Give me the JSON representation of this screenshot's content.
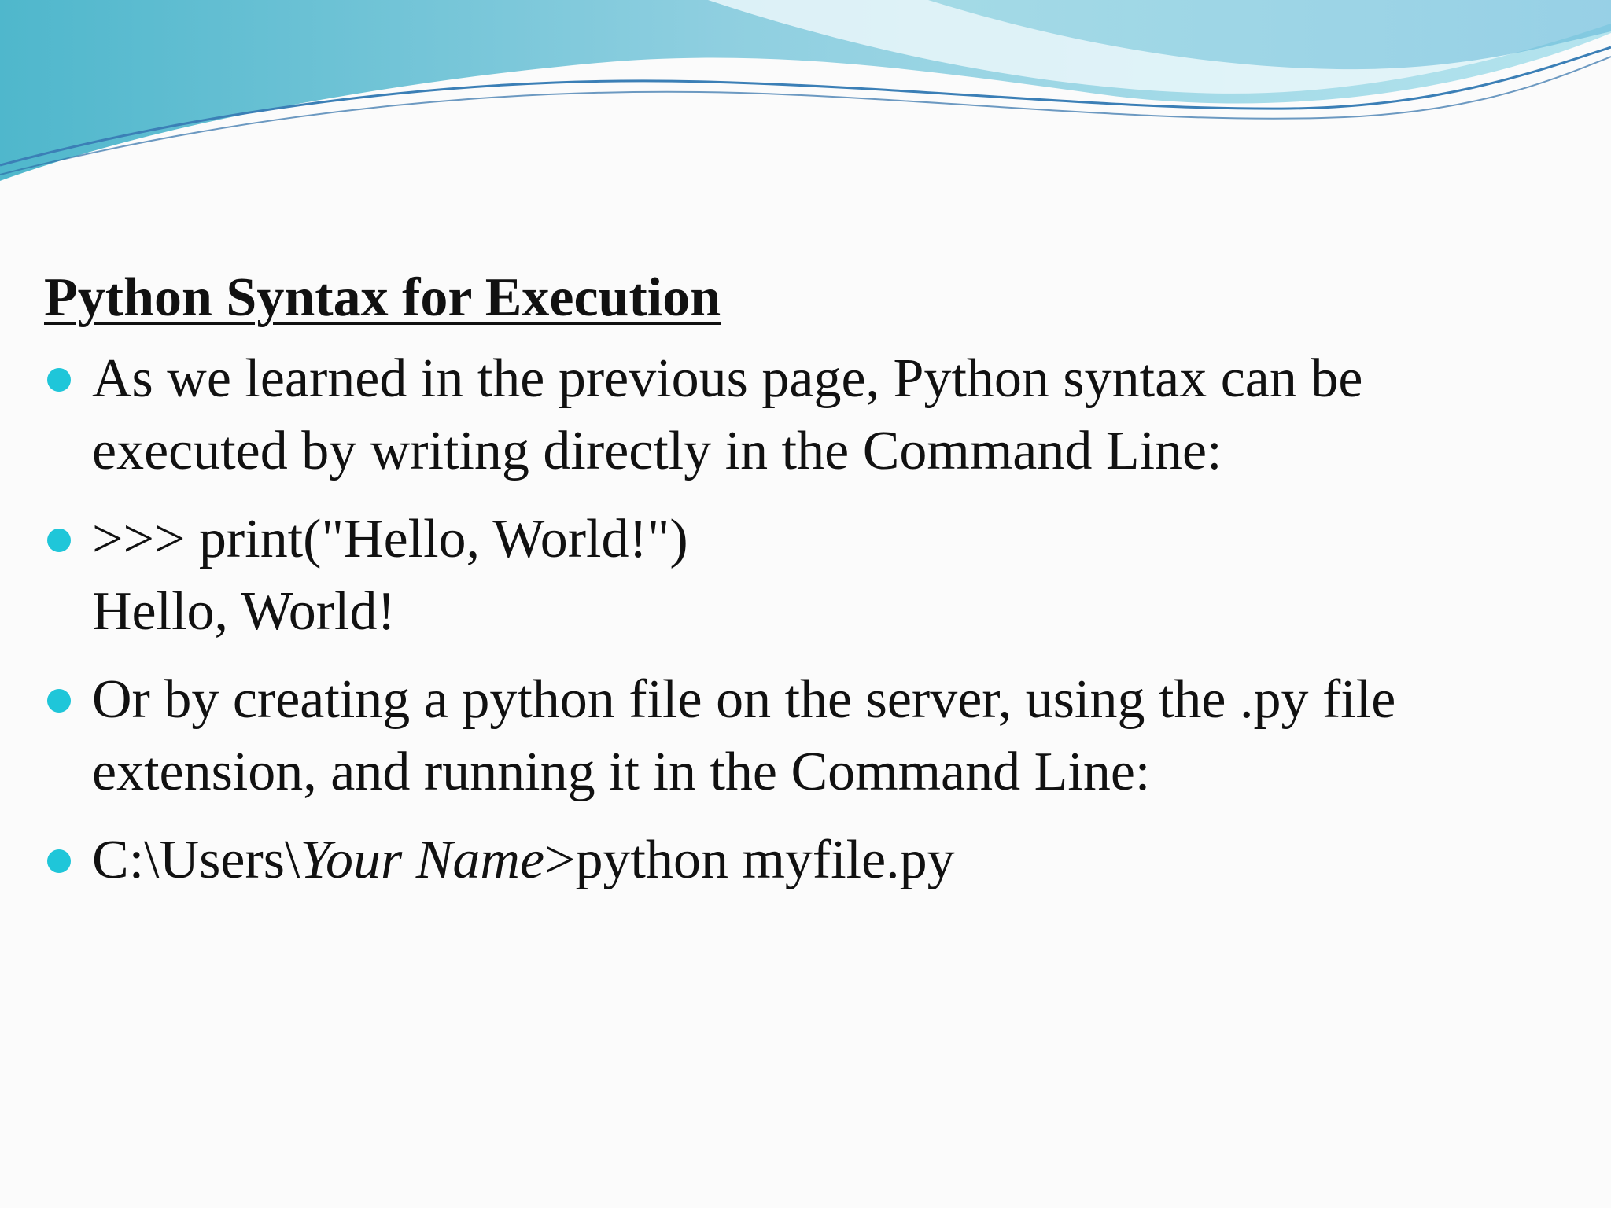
{
  "slide": {
    "heading": "Python Syntax for Execution",
    "bullets": [
      {
        "lines": [
          "As we learned in the previous page, Python syntax can be",
          "executed by writing directly in the Command Line:"
        ]
      },
      {
        "lines": [
          ">>> print(\"Hello, World!\")",
          "Hello, World!"
        ]
      },
      {
        "lines": [
          "Or by creating a python file on the server, using the .py file",
          "extension, and running it in the Command Line:"
        ]
      },
      {
        "parts": {
          "path_prefix": "C:\\Users\\",
          "user_name": "Your Name",
          "command": ">python myfile.py"
        }
      }
    ]
  },
  "colors": {
    "bullet": "#1fc6d9",
    "text": "#111111",
    "wave_dark": "#5bb3cf",
    "wave_light": "#a9dfea",
    "background": "#fbfbfb"
  }
}
